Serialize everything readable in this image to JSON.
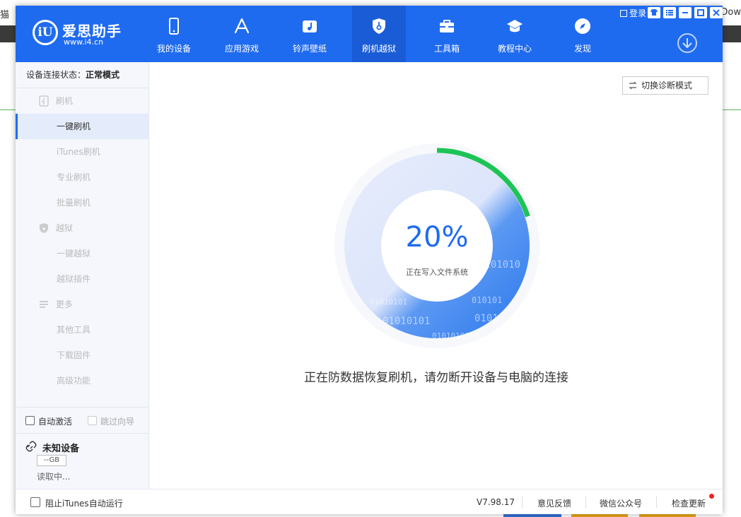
{
  "host": {
    "left_text": "猫",
    "right_text": "Dow"
  },
  "app": {
    "logo": {
      "name": "爱思助手",
      "url": "www.i4.cn",
      "mark": "iU"
    },
    "nav": [
      {
        "label": "我的设备",
        "icon": "phone-icon"
      },
      {
        "label": "应用游戏",
        "icon": "app-store-icon"
      },
      {
        "label": "铃声壁纸",
        "icon": "music-wallpaper-icon"
      },
      {
        "label": "刷机越狱",
        "icon": "shield-key-icon",
        "active": true
      },
      {
        "label": "工具箱",
        "icon": "toolbox-icon"
      },
      {
        "label": "教程中心",
        "icon": "graduation-cap-icon"
      },
      {
        "label": "发现",
        "icon": "compass-icon"
      }
    ],
    "login_label": "登录",
    "window_buttons": [
      "shirt-icon",
      "menu-icon",
      "minimize-icon",
      "maximize-icon",
      "close-icon"
    ]
  },
  "sidebar": {
    "connection_label": "设备连接状态：",
    "connection_value": "正常模式",
    "items": [
      {
        "label": "刷机",
        "type": "group",
        "icon": "flash-icon"
      },
      {
        "label": "一键刷机",
        "type": "sub",
        "active": true
      },
      {
        "label": "iTunes刷机",
        "type": "sub"
      },
      {
        "label": "专业刷机",
        "type": "sub"
      },
      {
        "label": "批量刷机",
        "type": "sub"
      },
      {
        "label": "越狱",
        "type": "group",
        "icon": "shield-icon"
      },
      {
        "label": "一键越狱",
        "type": "sub"
      },
      {
        "label": "越狱插件",
        "type": "sub"
      },
      {
        "label": "更多",
        "type": "group",
        "icon": "list-icon"
      },
      {
        "label": "其他工具",
        "type": "sub"
      },
      {
        "label": "下载固件",
        "type": "sub"
      },
      {
        "label": "高级功能",
        "type": "sub"
      }
    ],
    "auto_activate": "自动激活",
    "skip_guide": "跳过向导",
    "device": {
      "name": "未知设备",
      "capacity": "--GB",
      "status": "读取中..."
    }
  },
  "main": {
    "diag_button": "切换诊断模式",
    "progress": {
      "percent": 20,
      "percent_text": "20%",
      "label": "正在写入文件系统"
    },
    "decor_binary": [
      "0101010",
      "01010101",
      "010101",
      "01010101",
      "0101",
      "0101010101"
    ],
    "status_message": "正在防数据恢复刷机，请勿断开设备与电脑的连接"
  },
  "bottombar": {
    "block_itunes": "阻止iTunes自动运行",
    "version": "V7.98.17",
    "feedback": "意见反馈",
    "wechat": "微信公众号",
    "check_update": "检查更新"
  },
  "colors": {
    "primary": "#1f6bf0",
    "progress_green": "#1dc455",
    "sidebar_bg": "#f5f7fd",
    "update_dot": "#e22222"
  }
}
